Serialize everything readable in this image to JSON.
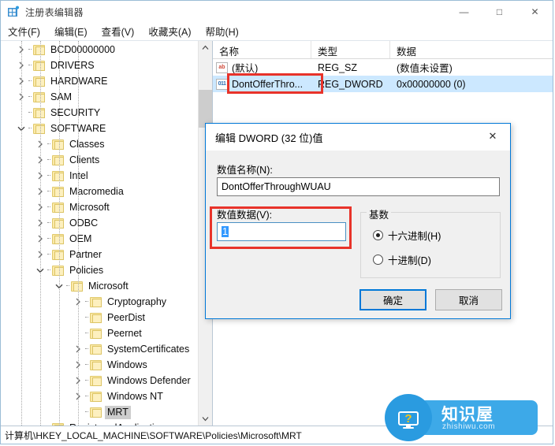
{
  "window": {
    "title": "注册表编辑器",
    "icon": "registry-grid-icon",
    "controls": {
      "minimize": "—",
      "maximize": "□",
      "close": "✕"
    }
  },
  "menubar": {
    "items": [
      {
        "label": "文件(F)"
      },
      {
        "label": "编辑(E)"
      },
      {
        "label": "查看(V)"
      },
      {
        "label": "收藏夹(A)"
      },
      {
        "label": "帮助(H)"
      }
    ]
  },
  "tree": {
    "nodes": [
      {
        "label": "BCD00000000",
        "indent": 1,
        "twist": "collapsed",
        "selected": false
      },
      {
        "label": "DRIVERS",
        "indent": 1,
        "twist": "collapsed",
        "selected": false
      },
      {
        "label": "HARDWARE",
        "indent": 1,
        "twist": "collapsed",
        "selected": false
      },
      {
        "label": "SAM",
        "indent": 1,
        "twist": "collapsed",
        "selected": false
      },
      {
        "label": "SECURITY",
        "indent": 1,
        "twist": "none",
        "selected": false
      },
      {
        "label": "SOFTWARE",
        "indent": 1,
        "twist": "expanded",
        "selected": false
      },
      {
        "label": "Classes",
        "indent": 2,
        "twist": "collapsed",
        "selected": false
      },
      {
        "label": "Clients",
        "indent": 2,
        "twist": "collapsed",
        "selected": false
      },
      {
        "label": "Intel",
        "indent": 2,
        "twist": "collapsed",
        "selected": false
      },
      {
        "label": "Macromedia",
        "indent": 2,
        "twist": "collapsed",
        "selected": false
      },
      {
        "label": "Microsoft",
        "indent": 2,
        "twist": "collapsed",
        "selected": false
      },
      {
        "label": "ODBC",
        "indent": 2,
        "twist": "collapsed",
        "selected": false
      },
      {
        "label": "OEM",
        "indent": 2,
        "twist": "collapsed",
        "selected": false
      },
      {
        "label": "Partner",
        "indent": 2,
        "twist": "collapsed",
        "selected": false
      },
      {
        "label": "Policies",
        "indent": 2,
        "twist": "expanded",
        "selected": false
      },
      {
        "label": "Microsoft",
        "indent": 3,
        "twist": "expanded",
        "selected": false
      },
      {
        "label": "Cryptography",
        "indent": 4,
        "twist": "collapsed",
        "selected": false
      },
      {
        "label": "PeerDist",
        "indent": 4,
        "twist": "none",
        "selected": false
      },
      {
        "label": "Peernet",
        "indent": 4,
        "twist": "none",
        "selected": false
      },
      {
        "label": "SystemCertificates",
        "indent": 4,
        "twist": "collapsed",
        "selected": false
      },
      {
        "label": "Windows",
        "indent": 4,
        "twist": "collapsed",
        "selected": false
      },
      {
        "label": "Windows Defender",
        "indent": 4,
        "twist": "collapsed",
        "selected": false
      },
      {
        "label": "Windows NT",
        "indent": 4,
        "twist": "collapsed",
        "selected": false
      },
      {
        "label": "MRT",
        "indent": 4,
        "twist": "none",
        "selected": true
      },
      {
        "label": "RegisteredApplications",
        "indent": 2,
        "twist": "none",
        "selected": false
      }
    ]
  },
  "list": {
    "columns": [
      "名称",
      "类型",
      "数据"
    ],
    "rows": [
      {
        "icon": "string-value-icon",
        "name": "(默认)",
        "type": "REG_SZ",
        "data": "(数值未设置)",
        "selected": false
      },
      {
        "icon": "dword-value-icon",
        "name": "DontOfferThro...",
        "type": "REG_DWORD",
        "data": "0x00000000 (0)",
        "selected": true
      }
    ]
  },
  "dialog": {
    "title": "编辑 DWORD (32 位)值",
    "close_label": "✕",
    "name_label": "数值名称(N):",
    "name_value": "DontOfferThroughWUAU",
    "data_label": "数值数据(V):",
    "data_value": "1",
    "base_group_label": "基数",
    "radios": [
      {
        "label": "十六进制(H)",
        "selected": true
      },
      {
        "label": "十进制(D)",
        "selected": false
      }
    ],
    "ok_label": "确定",
    "cancel_label": "取消"
  },
  "statusbar": {
    "path": "计算机\\HKEY_LOCAL_MACHINE\\SOFTWARE\\Policies\\Microsoft\\MRT"
  },
  "watermark": {
    "cn": "知识屋",
    "en": "zhishiwu.com",
    "icon": "monitor-question-icon"
  },
  "colors": {
    "accent": "#0078d7",
    "annotation": "#e8332a",
    "selection": "#cce8ff",
    "tree_selection": "#cdcdcd",
    "watermark_blue": "#2a9be0"
  }
}
